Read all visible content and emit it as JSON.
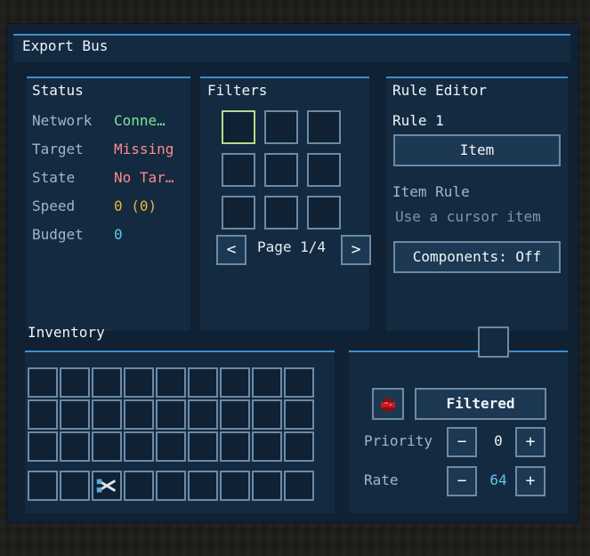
{
  "window": {
    "title": "Export Bus"
  },
  "status": {
    "title": "Status",
    "rows": [
      {
        "label": "Network",
        "value": "Conne…",
        "color": "#7fe39a"
      },
      {
        "label": "Target",
        "value": "Missing",
        "color": "#ff8a8a"
      },
      {
        "label": "State",
        "value": "No Tar…",
        "color": "#ff8a8a"
      },
      {
        "label": "Speed",
        "value": "0 (0)",
        "color": "#f0b23a"
      },
      {
        "label": "Budget",
        "value": "0",
        "color": "#5fc8e8"
      }
    ]
  },
  "filters": {
    "title": "Filters",
    "page_label": "Page 1/4",
    "prev_icon": "chevron-left-icon",
    "next_icon": "chevron-right-icon",
    "prev_glyph": "<",
    "next_glyph": ">"
  },
  "rule_editor": {
    "title": "Rule Editor",
    "rule_name": "Rule 1",
    "item_button": "Item",
    "item_rule_label": "Item Rule",
    "hint": "Use a cursor item",
    "components_button": "Components: Off"
  },
  "inventory": {
    "title": "Inventory",
    "hotbar_item_icon": "shears-icon"
  },
  "config": {
    "mode_button": "Filtered",
    "mode_icon": "redstone-dust-icon",
    "priority_label": "Priority",
    "priority_value": "0",
    "rate_label": "Rate",
    "rate_value": "64",
    "minus": "−",
    "plus": "+"
  },
  "colors": {
    "accent": "#3a8fd0",
    "panel": "#132a40",
    "window": "#0f2133",
    "selected_slot": "#b8d888",
    "redstone": "#c8191f"
  }
}
